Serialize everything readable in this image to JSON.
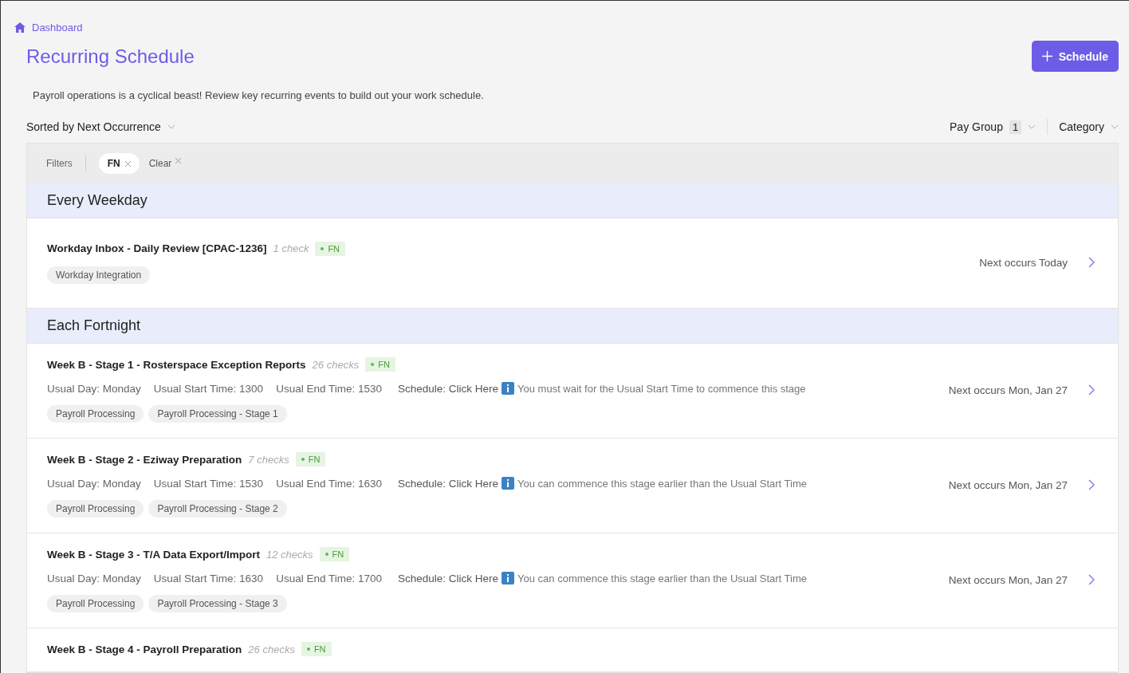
{
  "breadcrumb": {
    "label": "Dashboard"
  },
  "title": "Recurring Schedule",
  "add_button": {
    "label": "Schedule"
  },
  "description": "Payroll operations is a cyclical beast! Review key recurring events to build out your work schedule.",
  "sort": {
    "label": "Sorted by Next Occurrence"
  },
  "dropdowns": [
    {
      "label": "Pay Group",
      "count": "1"
    },
    {
      "label": "Category"
    }
  ],
  "filter_bar": {
    "label": "Filters",
    "chips": [
      {
        "label": "FN",
        "kind": "filter"
      },
      {
        "label": "Clear",
        "kind": "clear"
      }
    ]
  },
  "groups": [
    {
      "title": "Every Weekday",
      "items": [
        {
          "title": "Workday Inbox - Daily Review [CPAC-1236]",
          "checks": "1 check",
          "tag": {
            "label": "FN",
            "color": "#5cb85c"
          },
          "categories": [
            "Workday Integration"
          ],
          "next": "Next occurs Today"
        }
      ]
    },
    {
      "title": "Each Fortnight",
      "items": [
        {
          "title": "Week B - Stage 1 - Rosterspace Exception Reports",
          "checks": "26 checks",
          "tag": {
            "label": "FN",
            "color": "#5cb85c"
          },
          "details": [
            "Usual Day: Monday",
            "Usual Start Time: 1300",
            "Usual End Time: 1530"
          ],
          "schedule": "Schedule: Click Here",
          "note": "You must wait for the Usual Start Time to commence this stage",
          "categories": [
            "Payroll Processing",
            "Payroll Processing - Stage 1"
          ],
          "next": "Next occurs Mon, Jan 27"
        },
        {
          "title": "Week B - Stage 2 - Eziway Preparation",
          "checks": "7 checks",
          "tag": {
            "label": "FN",
            "color": "#5cb85c"
          },
          "details": [
            "Usual Day: Monday",
            "Usual Start Time: 1530",
            "Usual End Time: 1630"
          ],
          "schedule": "Schedule: Click Here",
          "note": "You can commence this stage earlier than the Usual Start Time",
          "categories": [
            "Payroll Processing",
            "Payroll Processing - Stage 2"
          ],
          "next": "Next occurs Mon, Jan 27"
        },
        {
          "title": "Week B - Stage 3 - T/A Data Export/Import",
          "checks": "12 checks",
          "tag": {
            "label": "FN",
            "color": "#5cb85c"
          },
          "details": [
            "Usual Day: Monday",
            "Usual Start Time: 1630",
            "Usual End Time: 1700"
          ],
          "schedule": "Schedule: Click Here",
          "note": "You can commence this stage earlier than the Usual Start Time",
          "categories": [
            "Payroll Processing",
            "Payroll Processing - Stage 3"
          ],
          "next": "Next occurs Mon, Jan 27"
        },
        {
          "title": "Week B - Stage 4 - Payroll Preparation",
          "checks": "26 checks",
          "tag": {
            "label": "FN",
            "color": "#5cb85c"
          }
        }
      ]
    }
  ]
}
